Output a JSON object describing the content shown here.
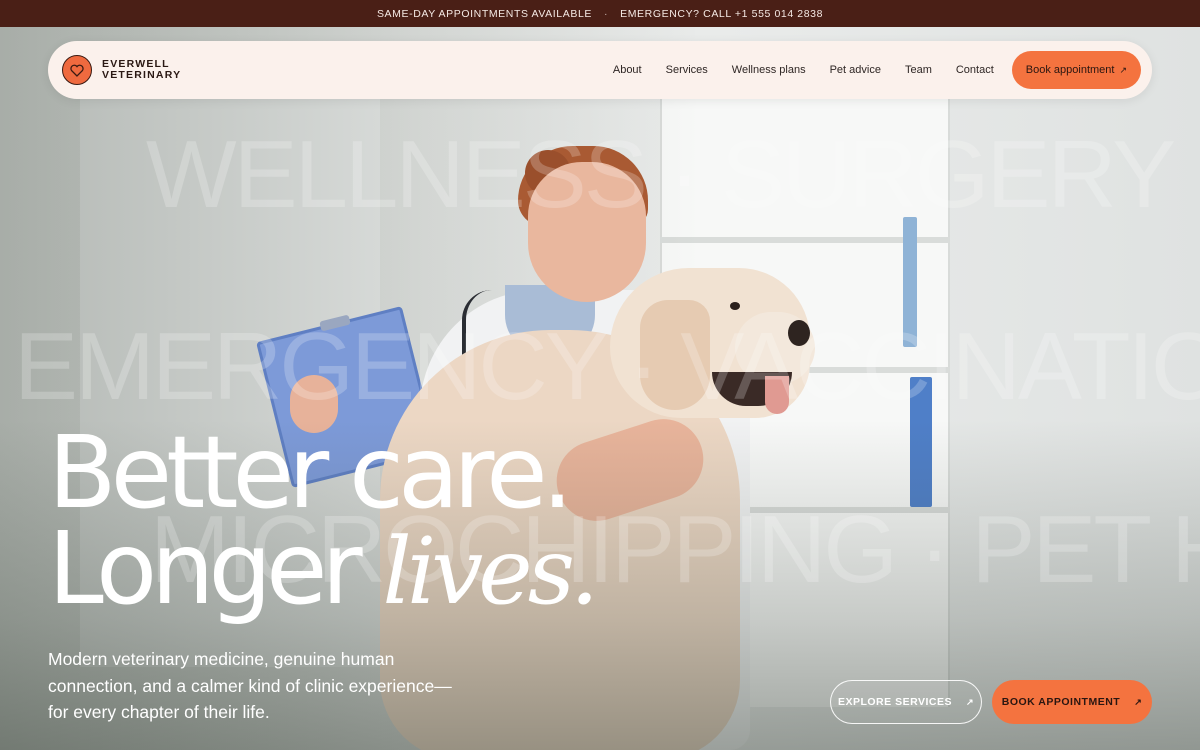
{
  "announcement": {
    "left": "SAME-DAY APPOINTMENTS AVAILABLE",
    "separator": "·",
    "right": "EMERGENCY? CALL +1 555 014 2838"
  },
  "brand": {
    "line1": "EVERWELL",
    "line2": "VETERINARY",
    "icon": "heart-icon",
    "accent_color": "#f4733f",
    "dark_color": "#4a1f16"
  },
  "nav": {
    "links": [
      "About",
      "Services",
      "Wellness plans",
      "Pet advice",
      "Team",
      "Contact"
    ],
    "cta_label": "Book appointment",
    "cta_icon": "↗"
  },
  "marquee": {
    "row1": "WELLNESS · SURGERY · DIAG",
    "row2": "EMERGENCY · VACCINATIONS",
    "row3": "MICROCHIPPING · PET HEAL"
  },
  "hero": {
    "headline_line1": "Better care.",
    "headline_line2_plain": "Longer ",
    "headline_line2_italic": "lives.",
    "subcopy": "Modern veterinary medicine, genuine human connection, and a calmer kind of clinic experience—for every chapter of their life."
  },
  "actions": {
    "explore_label": "EXPLORE SERVICES",
    "book_label": "BOOK APPOINTMENT",
    "arrow": "↗"
  }
}
